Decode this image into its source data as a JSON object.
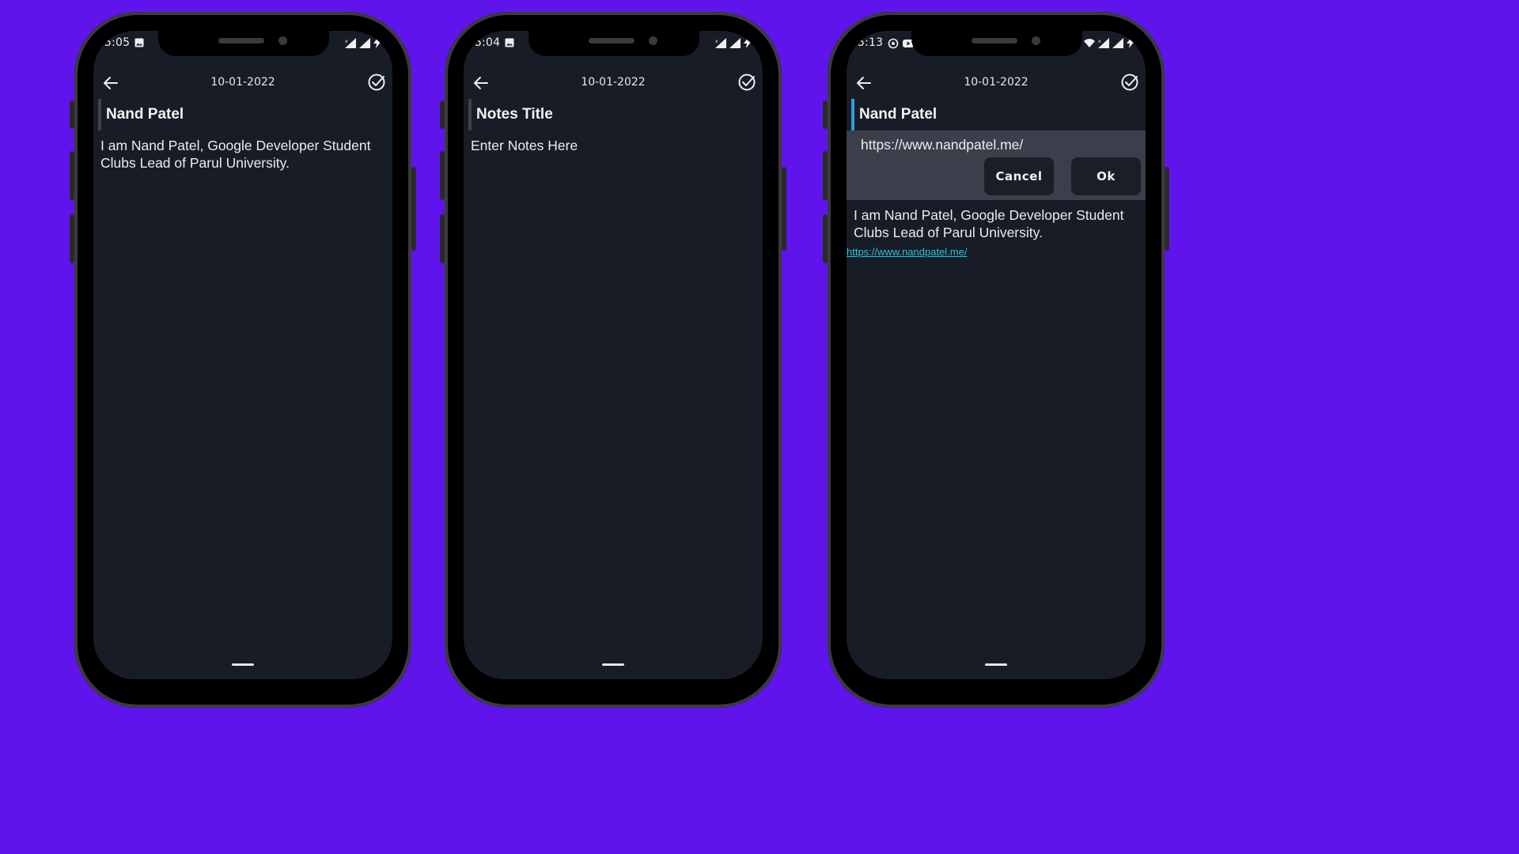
{
  "colors": {
    "background": "#5f14eb",
    "screen": "#181c27",
    "panel": "#3a3f4b",
    "link": "#28c6d8",
    "focus": "#2a9fe0"
  },
  "phones": [
    {
      "status": {
        "time": "5:05"
      },
      "header": {
        "date": "10-01-2022"
      },
      "note": {
        "title": "Nand Patel",
        "body": "I am Nand Patel, Google Developer Student Clubs Lead of Parul University."
      }
    },
    {
      "status": {
        "time": "5:04"
      },
      "header": {
        "date": "10-01-2022"
      },
      "note": {
        "title_placeholder": "Notes Title",
        "body_placeholder": "Enter Notes Here"
      }
    },
    {
      "status": {
        "time": "5:13"
      },
      "header": {
        "date": "10-01-2022"
      },
      "note": {
        "title": "Nand Patel",
        "body": "I am Nand Patel, Google Developer Student Clubs Lead of Parul University.",
        "link": "https://www.nandpatel.me/"
      },
      "link_dialog": {
        "input_value": "https://www.nandpatel.me/",
        "cancel_label": "Cancel",
        "ok_label": "Ok"
      }
    }
  ],
  "icons": {
    "back": "arrow-left-icon",
    "save": "check-circle-icon",
    "gallery": "image-icon",
    "whatsapp": "whatsapp-icon",
    "youtube": "youtube-icon",
    "signal": "signal-icon",
    "wifi": "wifi-icon",
    "charging": "bolt-icon"
  }
}
